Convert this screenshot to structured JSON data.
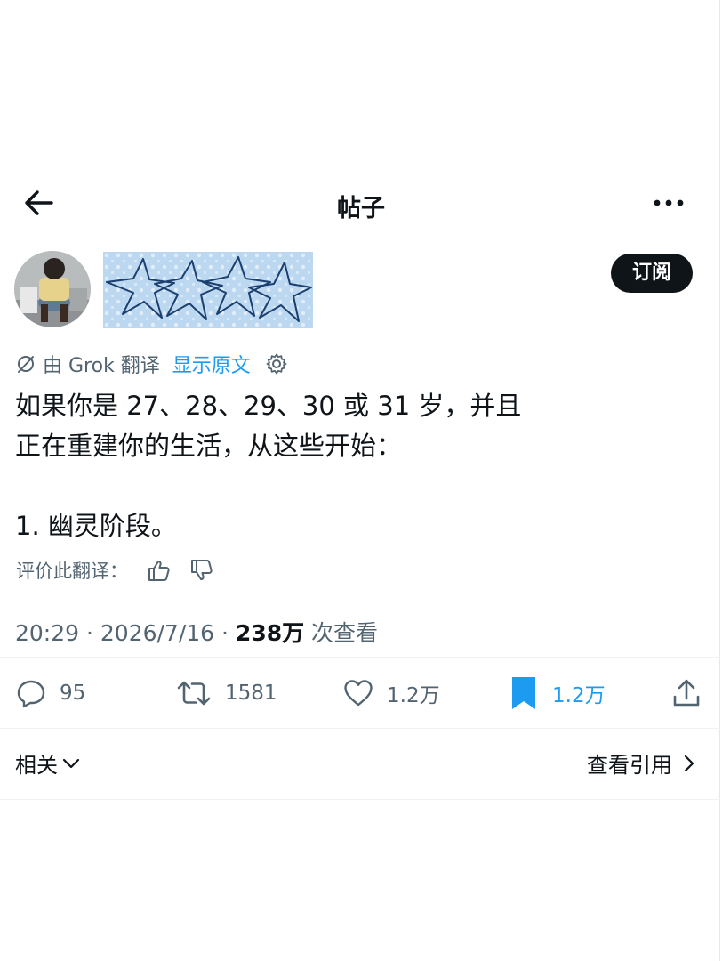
{
  "header": {
    "title": "帖子",
    "back_icon": "arrow-left-icon",
    "more_icon": "more-horizontal-icon"
  },
  "author": {
    "subscribe_label": "订阅"
  },
  "translation": {
    "prefix": "由 Grok 翻译",
    "show_original": "显示原文"
  },
  "post": {
    "lines": [
      "如果你是 27、28、29、30 或 31 岁，并且",
      "正在重建你的生活，从这些开始：",
      "1. 幽灵阶段。"
    ]
  },
  "rate": {
    "label": "评价此翻译："
  },
  "meta": {
    "time": "20:29 · 2026/7/16 · ",
    "views_count": "238万",
    "views_label": " 次查看"
  },
  "actions": {
    "replies": "95",
    "reposts": "1581",
    "likes": "1.2万",
    "bookmarks": "1.2万"
  },
  "footer": {
    "related": "相关",
    "view_quotes": "查看引用"
  },
  "colors": {
    "accent": "#1d9bf0",
    "text": "#0f1419",
    "muted": "#536471"
  }
}
